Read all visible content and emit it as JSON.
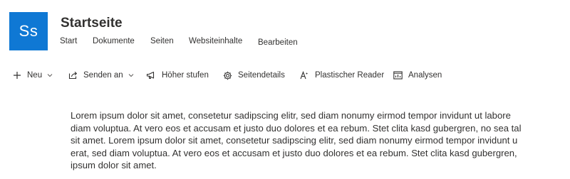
{
  "site": {
    "logo_initials": "Ss",
    "title": "Startseite",
    "accent_color": "#0f78d4"
  },
  "nav": {
    "items": [
      {
        "label": "Start"
      },
      {
        "label": "Dokumente"
      },
      {
        "label": "Seiten"
      },
      {
        "label": "Websiteinhalte"
      },
      {
        "label": "Bearbeiten"
      }
    ]
  },
  "commands": {
    "items": [
      {
        "label": "Neu",
        "icon": "plus-icon",
        "has_dropdown": true
      },
      {
        "label": "Senden an",
        "icon": "share-icon",
        "has_dropdown": true
      },
      {
        "label": "Höher stufen",
        "icon": "megaphone-icon",
        "has_dropdown": false
      },
      {
        "label": "Seitendetails",
        "icon": "gear-icon",
        "has_dropdown": false
      },
      {
        "label": "Plastischer Reader",
        "icon": "immersive-reader-icon",
        "has_dropdown": false
      },
      {
        "label": "Analysen",
        "icon": "analytics-icon",
        "has_dropdown": false
      }
    ]
  },
  "content": {
    "lines": [
      "Lorem ipsum dolor sit amet, consetetur sadipscing elitr, sed diam nonumy eirmod tempor invidunt ut labore",
      "diam voluptua. At vero eos et accusam et justo duo dolores et ea rebum. Stet clita kasd gubergren, no sea tal",
      "sit amet. Lorem ipsum dolor sit amet, consetetur sadipscing elitr, sed diam nonumy eirmod tempor invidunt u",
      "erat, sed diam voluptua. At vero eos et accusam et justo duo dolores et ea rebum. Stet clita kasd gubergren,",
      "ipsum dolor sit amet."
    ]
  }
}
